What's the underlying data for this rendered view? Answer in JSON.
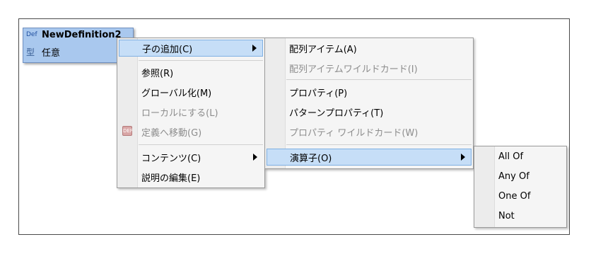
{
  "node": {
    "def_tag": "Def",
    "name": "NewDefinition2",
    "type_tag": "型",
    "type_value": "任意",
    "colors": {
      "fill": "#a9c8ee",
      "border": "#6f8fbf"
    }
  },
  "menu1": {
    "items": [
      {
        "label": "子の追加(C)"
      },
      {
        "label": "参照(R)"
      },
      {
        "label": "グローバル化(M)"
      },
      {
        "label": "ローカルにする(L)"
      },
      {
        "label": "定義へ移動(G)",
        "icon": "definition-icon",
        "icon_text": "DEF"
      },
      {
        "label": "コンテンツ(C)"
      },
      {
        "label": "説明の編集(E)"
      }
    ]
  },
  "menu2": {
    "items": [
      {
        "label": "配列アイテム(A)"
      },
      {
        "label": "配列アイテムワイルドカード(I)"
      },
      {
        "label": "プロパティ(P)"
      },
      {
        "label": "パターンプロパティ(T)"
      },
      {
        "label": "プロパティ ワイルドカード(W)"
      },
      {
        "label": "演算子(O)"
      }
    ]
  },
  "menu3": {
    "items": [
      {
        "label": "All Of"
      },
      {
        "label": "Any Of"
      },
      {
        "label": "One Of"
      },
      {
        "label": "Not"
      }
    ]
  },
  "colors": {
    "highlight": "#c6def7",
    "highlight_border": "#7fb0e3",
    "disabled_text": "#8d8d8d"
  }
}
